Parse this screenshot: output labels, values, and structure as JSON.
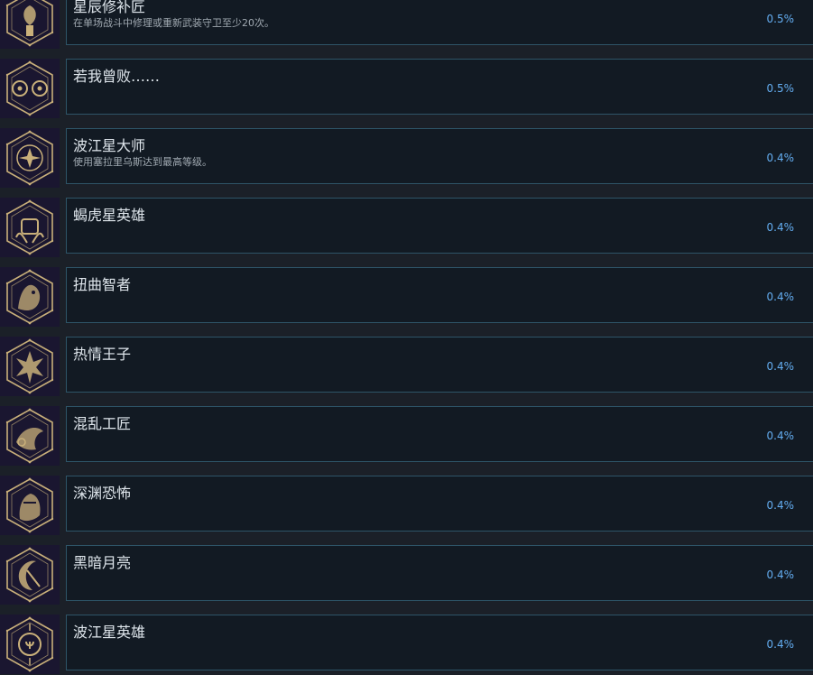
{
  "colors": {
    "page_bg": "#1b2028",
    "row_bg": "#121a23",
    "row_border": "#2e5467",
    "icon_bg": "#1a1630",
    "icon_gold": "#c9b07a",
    "title": "#dfe6ec",
    "description": "#a0a9b1",
    "percent": "#64aef2"
  },
  "achievements": [
    {
      "icon": "beacon-hexagon-icon",
      "title": "星辰修补匠",
      "description": "在单场战斗中修理或重新武装守卫至少20次。",
      "percent": "0.5%"
    },
    {
      "icon": "twin-eyes-icon",
      "title": "若我曾败……",
      "description": "",
      "percent": "0.5%"
    },
    {
      "icon": "star-emblem-icon",
      "title": "波江星大师",
      "description": "使用塞拉里乌斯达到最高等级。",
      "percent": "0.4%"
    },
    {
      "icon": "gecko-hero-icon",
      "title": "蝎虎星英雄",
      "description": "",
      "percent": "0.4%"
    },
    {
      "icon": "twisted-sage-icon",
      "title": "扭曲智者",
      "description": "",
      "percent": "0.4%"
    },
    {
      "icon": "passion-prince-icon",
      "title": "热情王子",
      "description": "",
      "percent": "0.4%"
    },
    {
      "icon": "chaos-artisan-icon",
      "title": "混乱工匠",
      "description": "",
      "percent": "0.4%"
    },
    {
      "icon": "abyss-horror-icon",
      "title": "深渊恐怖",
      "description": "",
      "percent": "0.4%"
    },
    {
      "icon": "dark-moon-icon",
      "title": "黑暗月亮",
      "description": "",
      "percent": "0.4%"
    },
    {
      "icon": "eridanus-hero-icon",
      "title": "波江星英雄",
      "description": "",
      "percent": "0.4%"
    }
  ]
}
